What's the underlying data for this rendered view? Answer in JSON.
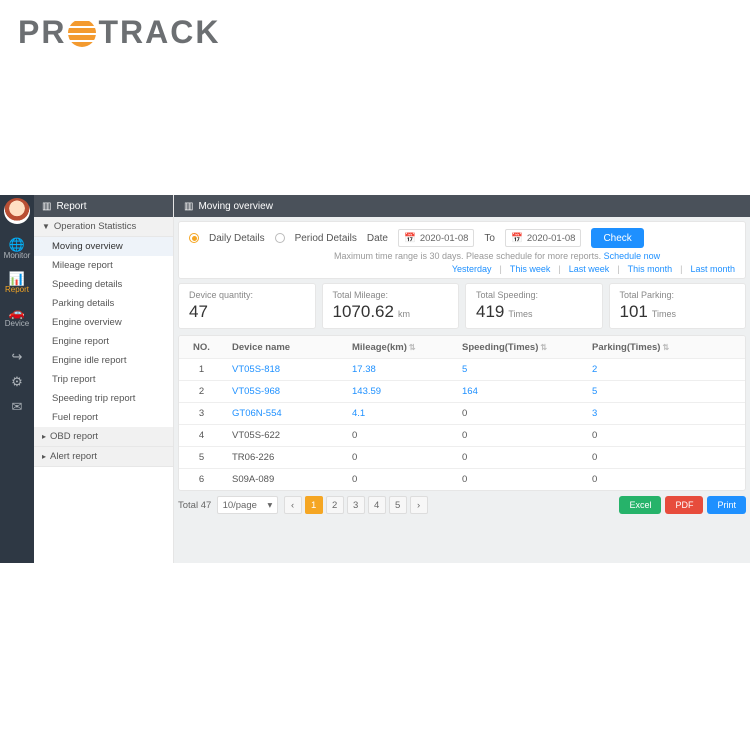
{
  "brand": {
    "pre": "PR",
    "post": "TRACK"
  },
  "iconbar": [
    {
      "icon": "🌐",
      "label": "Monitor"
    },
    {
      "icon": "📊",
      "label": "Report",
      "active": true
    },
    {
      "icon": "🚗",
      "label": "Device"
    }
  ],
  "iconbar_footer": [
    "↪",
    "⚙",
    "✉"
  ],
  "side": {
    "title": "Report",
    "groups": [
      {
        "label": "Operation Statistics",
        "open": true,
        "items": [
          {
            "label": "Moving overview",
            "active": true
          },
          {
            "label": "Mileage report"
          },
          {
            "label": "Speeding details"
          },
          {
            "label": "Parking details"
          },
          {
            "label": "Engine overview"
          },
          {
            "label": "Engine report"
          },
          {
            "label": "Engine idle report"
          },
          {
            "label": "Trip report"
          },
          {
            "label": "Speeding trip report"
          },
          {
            "label": "Fuel report"
          }
        ]
      },
      {
        "label": "OBD report",
        "open": false
      },
      {
        "label": "Alert report",
        "open": false
      }
    ]
  },
  "main": {
    "title": "Moving overview",
    "filter": {
      "opt_daily": "Daily Details",
      "opt_period": "Period Details",
      "date_lbl": "Date",
      "to_lbl": "To",
      "from": "2020-01-08",
      "to": "2020-01-08",
      "check": "Check",
      "note_a": "Maximum time range is 30 days. Please schedule for more reports. ",
      "note_b": "Schedule now",
      "ranges": [
        "Yesterday",
        "This week",
        "Last week",
        "This month",
        "Last month"
      ]
    },
    "cards": [
      {
        "label": "Device quantity:",
        "value": "47",
        "unit": ""
      },
      {
        "label": "Total Mileage:",
        "value": "1070.62",
        "unit": "km"
      },
      {
        "label": "Total Speeding:",
        "value": "419",
        "unit": "Times"
      },
      {
        "label": "Total Parking:",
        "value": "101",
        "unit": "Times"
      }
    ],
    "cols": [
      "NO.",
      "Device name",
      "Mileage(km)",
      "Speeding(Times)",
      "Parking(Times)"
    ],
    "rows": [
      {
        "no": "1",
        "name": "VT05S-818",
        "mi": "17.38",
        "sp": "5",
        "pk": "2",
        "link": true
      },
      {
        "no": "2",
        "name": "VT05S-968",
        "mi": "143.59",
        "sp": "164",
        "pk": "5",
        "link": true
      },
      {
        "no": "3",
        "name": "GT06N-554",
        "mi": "4.1",
        "sp": "0",
        "pk": "3",
        "link": true,
        "nolink_sp": true
      },
      {
        "no": "4",
        "name": "VT05S-622",
        "mi": "0",
        "sp": "0",
        "pk": "0"
      },
      {
        "no": "5",
        "name": "TR06-226",
        "mi": "0",
        "sp": "0",
        "pk": "0"
      },
      {
        "no": "6",
        "name": "S09A-089",
        "mi": "0",
        "sp": "0",
        "pk": "0"
      }
    ],
    "footer": {
      "total": "Total 47",
      "per": "10/page",
      "pages": [
        "1",
        "2",
        "3",
        "4",
        "5"
      ],
      "excel": "Excel",
      "pdf": "PDF",
      "print": "Print"
    }
  }
}
